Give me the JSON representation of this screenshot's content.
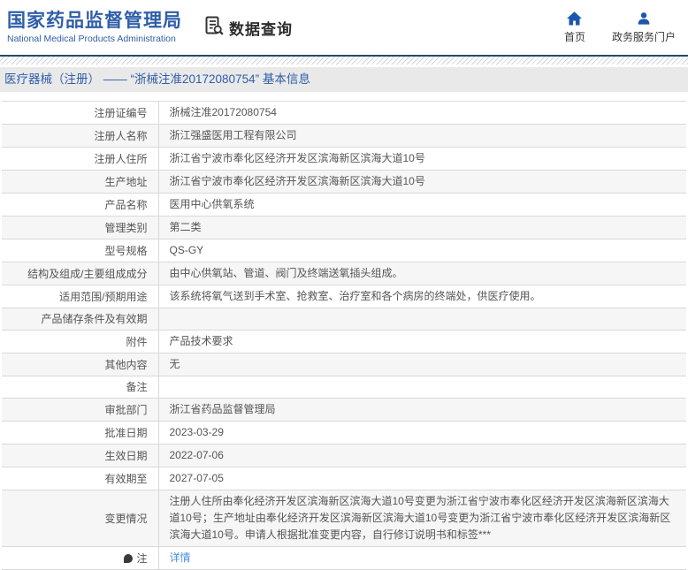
{
  "colors": {
    "brand_blue": "#2f5ea8",
    "nav_icon_blue": "#1c57ad",
    "navy_line": "#24496b",
    "title_band_bg": "#e9e9e9",
    "row_alt_bg": "#f6f6f6",
    "table_border": "#d9d9d9",
    "link_blue": "#4a90e2"
  },
  "header": {
    "logo_cn": "国家药品监督管理局",
    "logo_en": "National Medical Products Administration",
    "data_query_label": "数据查询",
    "nav": [
      {
        "label": "首页",
        "icon": "home-icon"
      },
      {
        "label": "政务服务门户",
        "icon": "user-icon"
      }
    ]
  },
  "page_title": "医疗器械（注册） —— “浙械注准20172080754” 基本信息",
  "table": {
    "rows": [
      {
        "label": "注册证编号",
        "value": "浙械注准20172080754"
      },
      {
        "label": "注册人名称",
        "value": "浙江强盛医用工程有限公司"
      },
      {
        "label": "注册人住所",
        "value": "浙江省宁波市奉化区经济开发区滨海新区滨海大道10号"
      },
      {
        "label": "生产地址",
        "value": "浙江省宁波市奉化区经济开发区滨海新区滨海大道10号"
      },
      {
        "label": "产品名称",
        "value": "医用中心供氧系统"
      },
      {
        "label": "管理类别",
        "value": "第二类"
      },
      {
        "label": "型号规格",
        "value": "QS-GY"
      },
      {
        "label": "结构及组成/主要组成成分",
        "value": "由中心供氧站、管道、阀门及终端送氧插头组成。"
      },
      {
        "label": "适用范围/预期用途",
        "value": "该系统将氧气送到手术室、抢救室、治疗室和各个病房的终端处，供医疗使用。"
      },
      {
        "label": "产品储存条件及有效期",
        "value": ""
      },
      {
        "label": "附件",
        "value": "产品技术要求"
      },
      {
        "label": "其他内容",
        "value": "无"
      },
      {
        "label": "备注",
        "value": ""
      },
      {
        "label": "审批部门",
        "value": "浙江省药品监督管理局"
      },
      {
        "label": "批准日期",
        "value": "2023-03-29"
      },
      {
        "label": "生效日期",
        "value": "2022-07-06"
      },
      {
        "label": "有效期至",
        "value": "2027-07-05"
      },
      {
        "label": "变更情况",
        "value": "注册人住所由奉化经济开发区滨海新区滨海大道10号变更为浙江省宁波市奉化区经济开发区滨海新区滨海大道10号；生产地址由奉化经济开发区滨海新区滨海大道10号变更为浙江省宁波市奉化区经济开发区滨海新区滨海大道10号。申请人根据批准变更内容，自行修订说明书和标签***"
      },
      {
        "label": "注",
        "label_icon": "note-icon",
        "value": "详情",
        "link": true
      }
    ]
  }
}
